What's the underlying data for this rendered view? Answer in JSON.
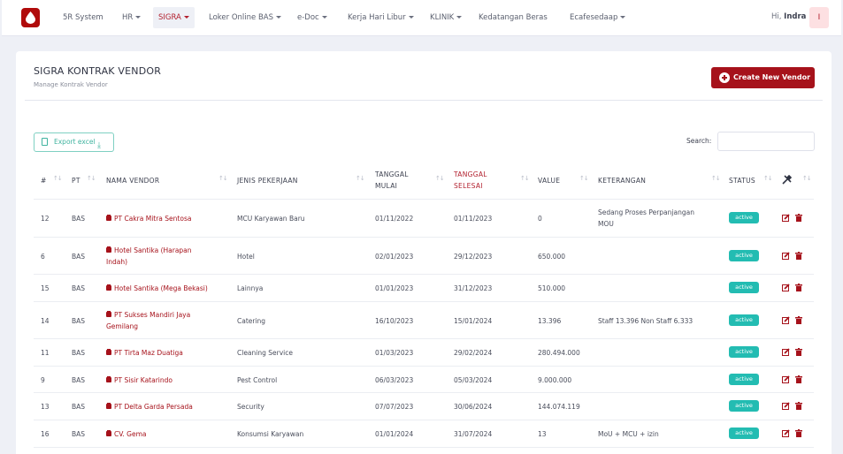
{
  "nav": {
    "items": [
      {
        "label": "5R System",
        "caret": false
      },
      {
        "label": "HR",
        "caret": true
      },
      {
        "label": "SIGRA",
        "caret": true,
        "active": true
      },
      {
        "label": "Loker Online BAS",
        "caret": true
      },
      {
        "label": "e-Doc",
        "caret": true
      },
      {
        "label": "Kerja Hari Libur",
        "caret": true
      },
      {
        "label": "KLINIK",
        "caret": true
      },
      {
        "label": "Kedatangan Beras",
        "caret": false
      },
      {
        "label": "Ecafesedaap",
        "caret": true
      }
    ],
    "greeting": "Hi,",
    "user": "Indra",
    "avatar_letter": "I"
  },
  "page": {
    "title": "SIGRA KONTRAK VENDOR",
    "subtitle": "Manage Kontrak Vendor",
    "create_button": "Create New Vendor",
    "export_button": "Export excel",
    "search_label": "Search:",
    "search_value": ""
  },
  "table": {
    "headers": {
      "no": "#",
      "pt": "PT",
      "vendor": "NAMA VENDOR",
      "job": "JENIS PEKERJAAN",
      "start_1": "TANGGAL",
      "start_2": "MULAI",
      "end_1": "TANGGAL",
      "end_2": "SELESAI",
      "value": "VALUE",
      "note": "KETERANGAN",
      "status": "STATUS"
    },
    "rows": [
      {
        "no": "12",
        "pt": "BAS",
        "vendor_1": "PT Cakra Mitra Sentosa",
        "vendor_2": "",
        "job": "MCU Karyawan Baru",
        "start": "01/11/2022",
        "end": "01/11/2023",
        "value": "0",
        "note_1": "Sedang Proses Perpanjangan",
        "note_2": "MOU",
        "status": "active"
      },
      {
        "no": "6",
        "pt": "BAS",
        "vendor_1": "Hotel Santika (Harapan",
        "vendor_2": "Indah)",
        "job": "Hotel",
        "start": "02/01/2023",
        "end": "29/12/2023",
        "value": "650.000",
        "note_1": "",
        "note_2": "",
        "status": "active"
      },
      {
        "no": "15",
        "pt": "BAS",
        "vendor_1": "Hotel Santika (Mega Bekasi)",
        "vendor_2": "",
        "job": "Lainnya",
        "start": "01/01/2023",
        "end": "31/12/2023",
        "value": "510.000",
        "note_1": "",
        "note_2": "",
        "status": "active"
      },
      {
        "no": "14",
        "pt": "BAS",
        "vendor_1": "PT Sukses Mandiri Jaya",
        "vendor_2": "Gemilang",
        "job": "Catering",
        "start": "16/10/2023",
        "end": "15/01/2024",
        "value": "13.396",
        "note_1": "Staff 13.396 Non Staff 6.333",
        "note_2": "",
        "status": "active"
      },
      {
        "no": "11",
        "pt": "BAS",
        "vendor_1": "PT Tirta Maz Duatiga",
        "vendor_2": "",
        "job": "Cleaning Service",
        "start": "01/03/2023",
        "end": "29/02/2024",
        "value": "280.494.000",
        "note_1": "",
        "note_2": "",
        "status": "active"
      },
      {
        "no": "9",
        "pt": "BAS",
        "vendor_1": "PT Sisir Katarindo",
        "vendor_2": "",
        "job": "Pest Control",
        "start": "06/03/2023",
        "end": "05/03/2024",
        "value": "9.000.000",
        "note_1": "",
        "note_2": "",
        "status": "active"
      },
      {
        "no": "13",
        "pt": "BAS",
        "vendor_1": "PT Delta Garda Persada",
        "vendor_2": "",
        "job": "Security",
        "start": "07/07/2023",
        "end": "30/06/2024",
        "value": "144.074.119",
        "note_1": "",
        "note_2": "",
        "status": "active"
      },
      {
        "no": "16",
        "pt": "BAS",
        "vendor_1": "CV. Gema",
        "vendor_2": "",
        "job": "Konsumsi Karyawan",
        "start": "01/01/2024",
        "end": "31/07/2024",
        "value": "13",
        "note_1": "MoU + MCU + izin",
        "note_2": "",
        "status": "active"
      }
    ]
  },
  "colors": {
    "accent": "#a6121b",
    "status_active": "#23bcb2",
    "export": "#3fb39f"
  }
}
